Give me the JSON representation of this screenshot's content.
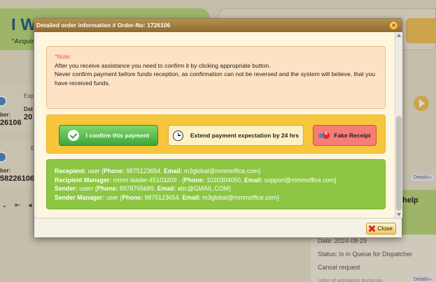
{
  "background": {
    "hero_title": "I W",
    "hero_subtitle": "\"Acquir",
    "row1": {
      "label_exp": "Expe",
      "label_date": "Dat",
      "label_number": "ber:",
      "number": "26106",
      "date_partial": "20"
    },
    "row2": {
      "label_e": "E",
      "label_number": "ber:",
      "number": "58226106"
    },
    "pager": [
      "⌄",
      "⇤",
      "◂"
    ],
    "details_link": "Details››",
    "help_title": "help",
    "side_list": [
      "Date: 2024-08-29",
      "Status: Is in Queue for Dispatcher",
      "Cancel request",
      "Letter of assistance during pa..."
    ]
  },
  "modal": {
    "title": "Detailed order information # Order-No: 1726106",
    "close_x": "×",
    "note": {
      "title": "*Note:",
      "lines": [
        "After you receive assistance you need to confirm it by clicking appropriate button.",
        "Never confirm payment before funds reception, as confirmation can not be reversed and the system will believe, that you have received funds."
      ]
    },
    "buttons": {
      "confirm": "I confirm this payment",
      "extend": "Extend payment expectation by 24 hrs",
      "fake": "Fake Receipt"
    },
    "info": {
      "recipient": {
        "label": "Recepient:",
        "name": "user",
        "phone_label": "Phone:",
        "phone": "9875123654",
        "email_label": "Email:",
        "email": "m3global@mmmoffice.com"
      },
      "recipient_manager": {
        "label": "Recipient Manager:",
        "name": "mmm leader-45103209 .",
        "phone_label": "Phone:",
        "phone": "1020304050",
        "email_label": "Email:",
        "email": "support@mmmoffice.com"
      },
      "sender": {
        "label": "Sender:",
        "name": "userr",
        "phone_label": "Phone:",
        "phone": "8978765689",
        "email_label": "Email:",
        "email": "abc@GMAIL.COM"
      },
      "sender_manager": {
        "label": "Sender Manager:",
        "name": "user",
        "phone_label": "Phone:",
        "phone": "9875123654",
        "email_label": "Email:",
        "email": "m3global@mmmoffice.com"
      }
    },
    "footer_close": "Close"
  }
}
